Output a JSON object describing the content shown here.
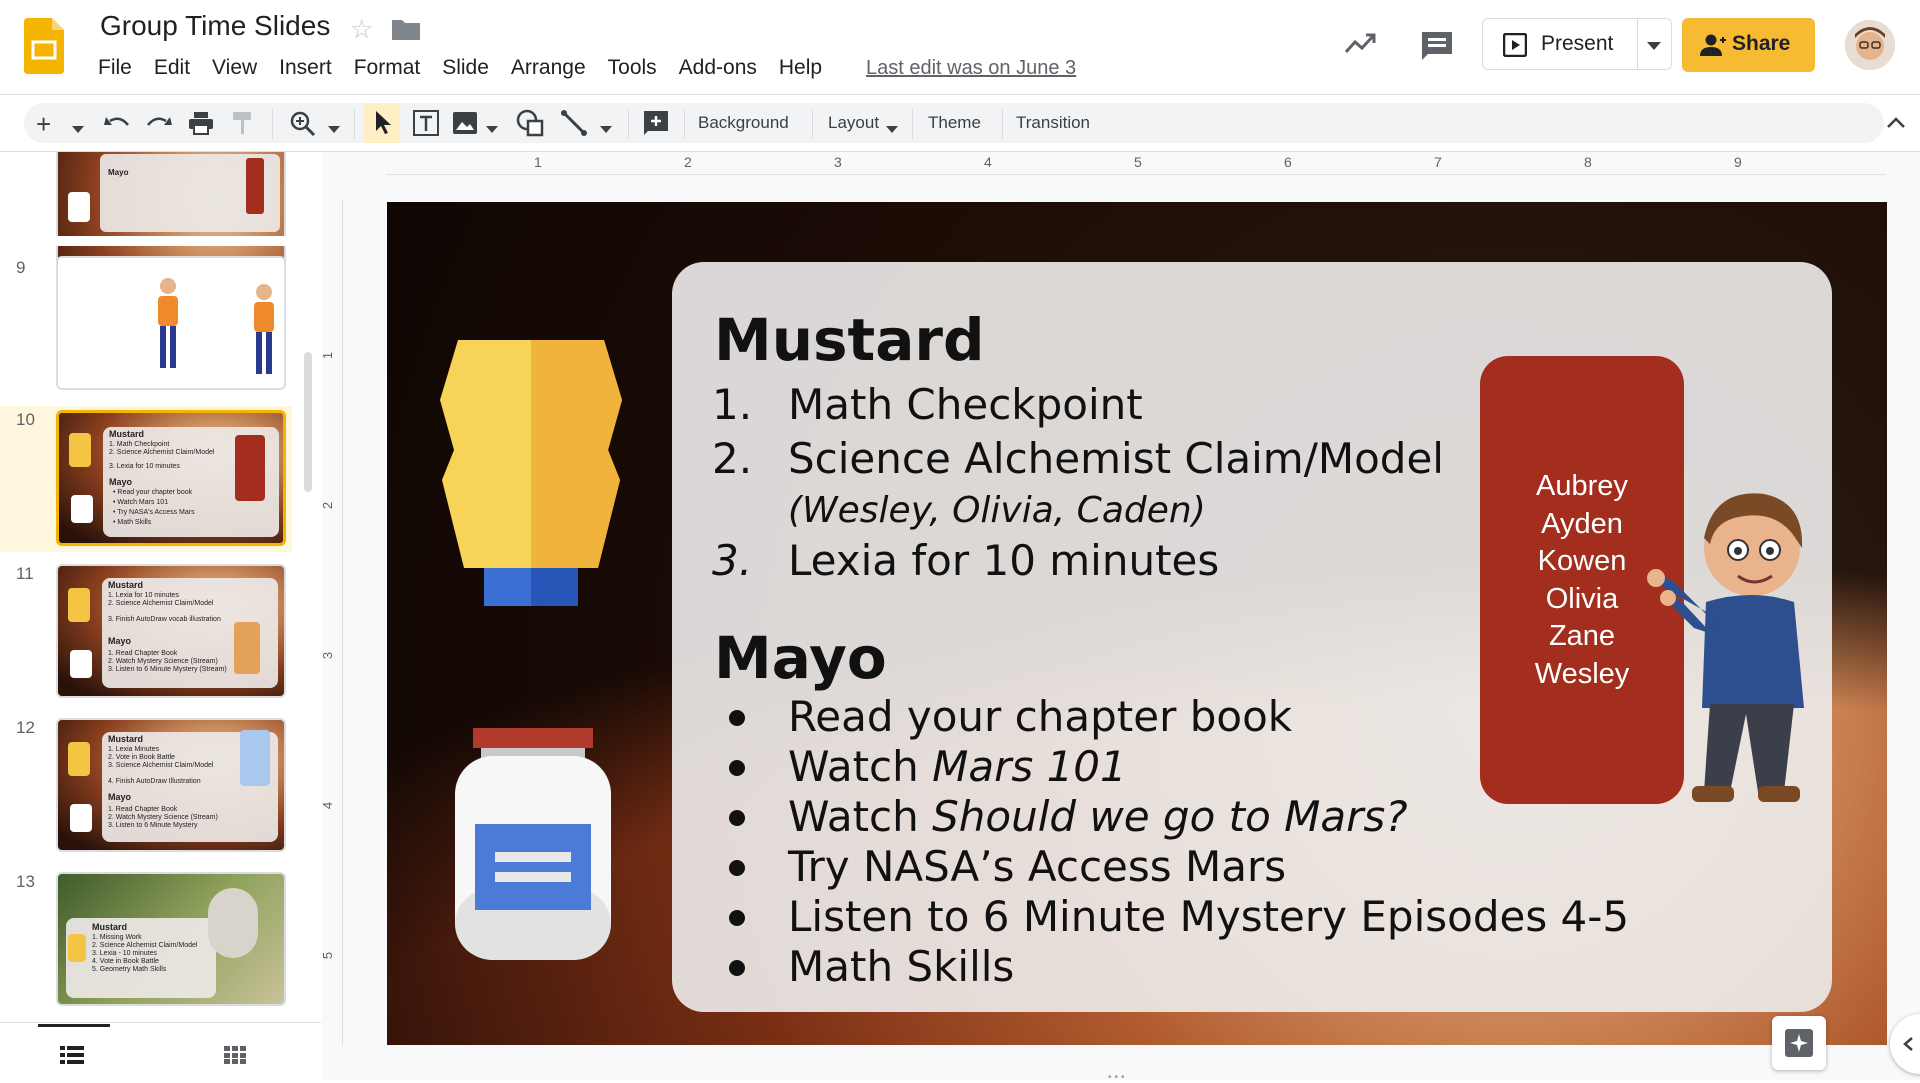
{
  "app": {
    "doc_title": "Group Time Slides",
    "menu": [
      "File",
      "Edit",
      "View",
      "Insert",
      "Format",
      "Slide",
      "Arrange",
      "Tools",
      "Add-ons",
      "Help"
    ],
    "last_edit": "Last edit was on June 3",
    "present_label": "Present",
    "share_label": "Share",
    "accent_color": "#f6bb33"
  },
  "toolbar": {
    "background_label": "Background",
    "layout_label": "Layout",
    "theme_label": "Theme",
    "transition_label": "Transition"
  },
  "ruler": {
    "h_numbers": [
      "1",
      "2",
      "3",
      "4",
      "5",
      "6",
      "7",
      "8",
      "9"
    ],
    "v_numbers": [
      "1",
      "2",
      "3",
      "4",
      "5"
    ]
  },
  "filmstrip": {
    "slides": [
      {
        "number": "9"
      },
      {
        "number": "10",
        "selected": true
      },
      {
        "number": "11"
      },
      {
        "number": "12"
      },
      {
        "number": "13"
      }
    ]
  },
  "slide": {
    "mustard_heading": "Mustard",
    "mustard_items": [
      {
        "n": "1.",
        "text": "Math Checkpoint"
      },
      {
        "n": "2.",
        "text": "Science Alchemist Claim/Model"
      },
      {
        "n": "3.",
        "text": "Lexia for 10 minutes"
      }
    ],
    "mustard_note": "(Wesley, Olivia, Caden)",
    "mayo_heading": "Mayo",
    "mayo_items": [
      {
        "plain": "Read your chapter book",
        "italic": ""
      },
      {
        "plain": "Watch ",
        "italic": "Mars 101"
      },
      {
        "plain": "Watch ",
        "italic": "Should we go to Mars?"
      },
      {
        "plain": "Try NASA’s Access Mars",
        "italic": ""
      },
      {
        "plain": "Listen to 6 Minute Mystery Episodes 4-5",
        "italic": ""
      },
      {
        "plain": "Math Skills",
        "italic": ""
      }
    ],
    "names": [
      "Aubrey",
      "Ayden",
      "Kowen",
      "Olivia",
      "Zane",
      "Wesley"
    ],
    "namebox_color": "#a32e1d"
  }
}
